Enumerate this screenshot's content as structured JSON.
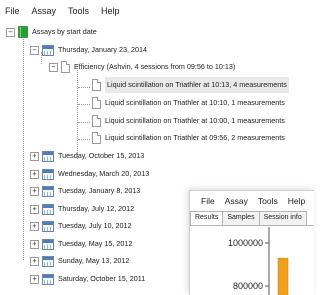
{
  "menubar": {
    "items": [
      "File",
      "Assay",
      "Tools",
      "Help"
    ]
  },
  "tree": {
    "root_label": "Assays by start date",
    "expanded_date": "Thursday, January 23, 2014",
    "group_label": "Efficiency (Ashvin, 4 sessions from 09:56 to 10:13)",
    "sessions": [
      "Liquid scintillation on Triathler at 10:13, 4 measurements",
      "Liquid scintillation on Triathler at 10:10, 1 measurements",
      "Liquid scintillation on Triathler at 10:00, 1 measurements",
      "Liquid scintillation on Triathler at 09:56, 2 measurements"
    ],
    "collapsed_dates": [
      "Tuesday, October 15, 2013",
      "Wednesday, March 20, 2013",
      "Tuesday, January 8, 2013",
      "Thursday, July 12, 2012",
      "Tuesday, July 10, 2012",
      "Tuesday, May 15, 2012",
      "Sunday, May 13, 2012",
      "Saturday, October 15, 2011"
    ]
  },
  "overlay_window": {
    "menubar": [
      "File",
      "Assay",
      "Tools",
      "Help"
    ],
    "tabs": [
      "Results",
      "Samples",
      "Session info"
    ],
    "active_tab": "Results",
    "y_ticks": [
      "1000000",
      "800000"
    ],
    "bar_color": "#f0a020",
    "chart_data": {
      "type": "bar",
      "y_ticks": [
        1000000,
        800000
      ],
      "values": [
        930000
      ]
    }
  },
  "colors": {
    "bar": "#f0a020",
    "selection": "#e9e9e9"
  }
}
